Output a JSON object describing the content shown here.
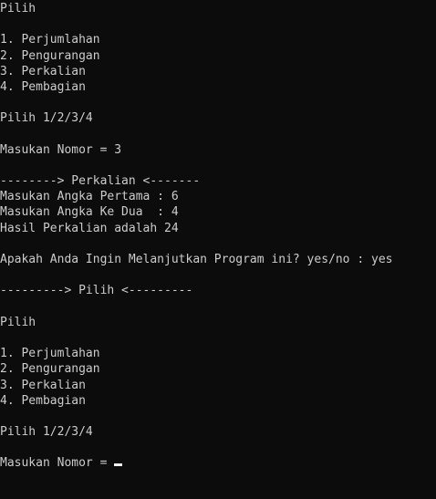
{
  "console": {
    "lines": [
      "Pilih",
      "",
      "1. Perjumlahan",
      "2. Pengurangan",
      "3. Perkalian",
      "4. Pembagian",
      "",
      "Pilih 1/2/3/4",
      "",
      "Masukan Nomor = 3",
      "",
      "--------> Perkalian <-------",
      "Masukan Angka Pertama : 6",
      "Masukan Angka Ke Dua  : 4",
      "Hasil Perkalian adalah 24",
      "",
      "Apakah Anda Ingin Melanjutkan Program ini? yes/no : yes",
      "",
      "---------> Pilih <---------",
      "",
      "Pilih",
      "",
      "1. Perjumlahan",
      "2. Pengurangan",
      "3. Perkalian",
      "4. Pembagian",
      "",
      "Pilih 1/2/3/4",
      "",
      "Masukan Nomor = "
    ],
    "text_color": "#cccccc",
    "background_color": "#0c0c0c",
    "cursor_color": "#f2f2f2"
  }
}
